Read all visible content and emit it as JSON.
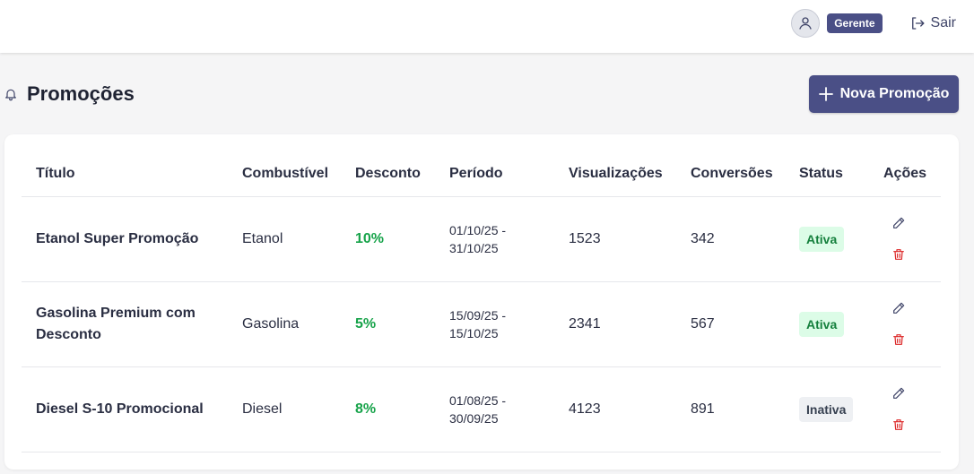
{
  "header": {
    "role": "Gerente",
    "logout_label": "Sair"
  },
  "page": {
    "title": "Promoções",
    "new_button_label": "Nova Promoção"
  },
  "table": {
    "columns": [
      "Título",
      "Combustível",
      "Desconto",
      "Período",
      "Visualizações",
      "Conversões",
      "Status",
      "Ações"
    ],
    "rows": [
      {
        "title": "Etanol Super Promoção",
        "fuel": "Etanol",
        "discount": "10%",
        "period": "01/10/25 -\n31/10/25",
        "views": "1523",
        "conversions": "342",
        "status": "Ativa"
      },
      {
        "title": "Gasolina Premium com Desconto",
        "fuel": "Gasolina",
        "discount": "5%",
        "period": "15/09/25 -\n15/10/25",
        "views": "2341",
        "conversions": "567",
        "status": "Ativa"
      },
      {
        "title": "Diesel S-10 Promocional",
        "fuel": "Diesel",
        "discount": "8%",
        "period": "01/08/25 -\n30/09/25",
        "views": "4123",
        "conversions": "891",
        "status": "Inativa"
      }
    ]
  },
  "colors": {
    "brand": "#4a4f86",
    "discount": "#17a34a",
    "active_bg": "#dcfce7",
    "active_text": "#15803d",
    "inactive_bg": "#eef0f3",
    "delete": "#dc2626"
  },
  "icons": {
    "avatar": "user-icon",
    "logout": "logout-icon",
    "title": "bell-icon",
    "new": "plus-icon",
    "edit": "pencil-icon",
    "delete": "trash-icon"
  }
}
